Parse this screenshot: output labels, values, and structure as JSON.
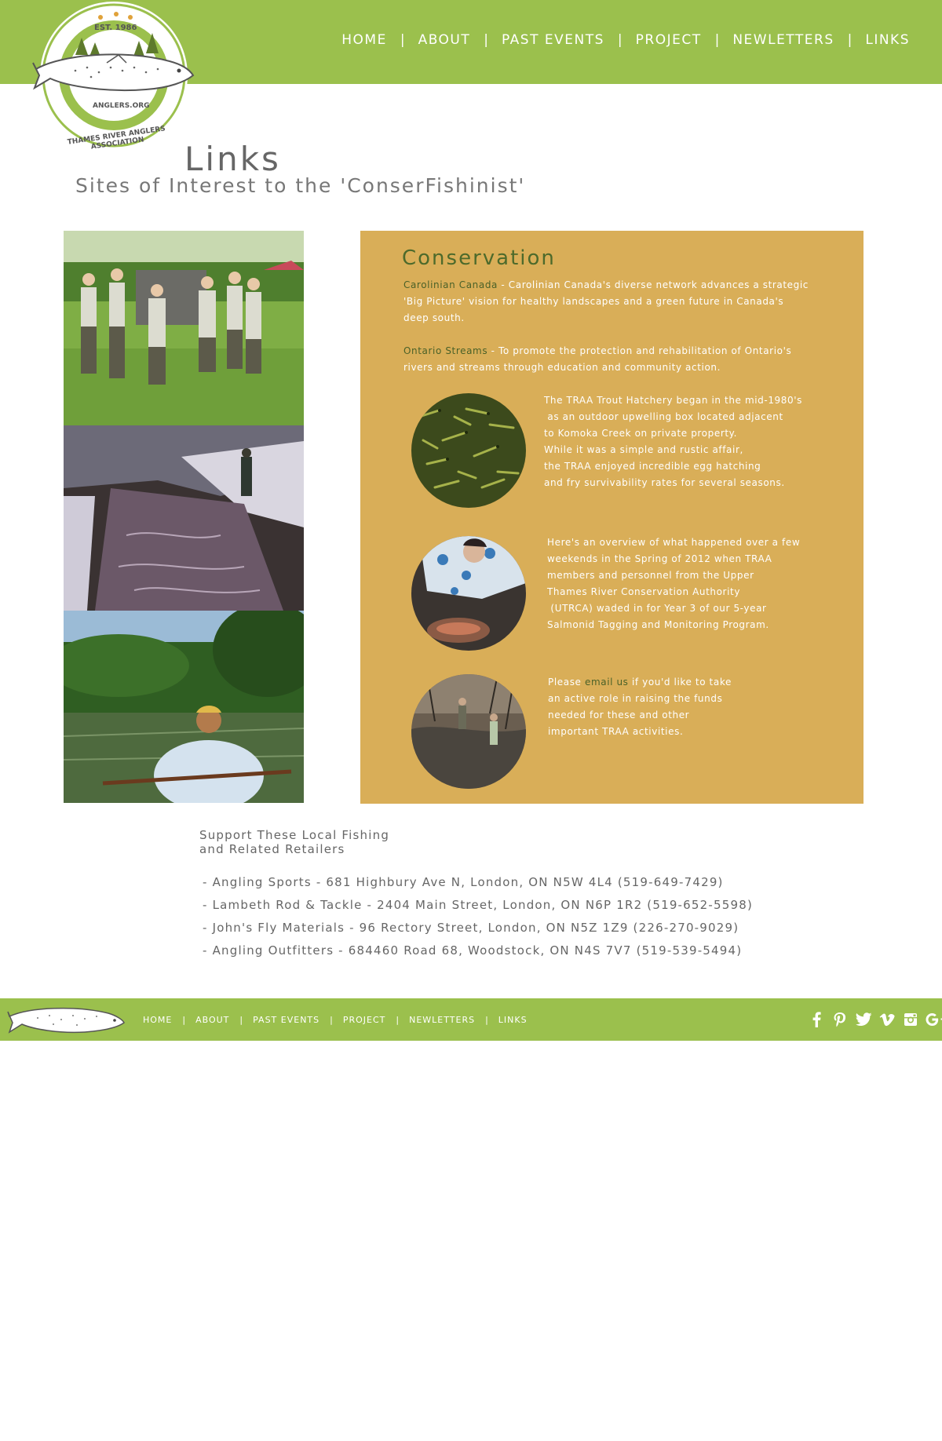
{
  "header": {
    "logo": {
      "est": "EST. 1986",
      "site": "ANGLERS.ORG",
      "name": "THAMES RIVER ANGLERS ASSOCIATION"
    },
    "nav": [
      "HOME",
      "ABOUT",
      "PAST EVENTS",
      "PROJECT",
      "NEWLETTERS",
      "LINKS"
    ]
  },
  "page": {
    "title": "Links",
    "subtitle": "Sites of Interest to the 'ConserFishinist'"
  },
  "conservation": {
    "title": "Conservation",
    "p1_link": "Carolinian Canada",
    "p1_text": " - Carolinian Canada's diverse network advances a strategic 'Big Picture' vision for healthy landscapes and a green future in Canada's deep south.",
    "p2_link": "Ontario Streams",
    "p2_text": " - To promote the protection and rehabilitation of Ontario's rivers and streams through education and community action.",
    "p3_lines": [
      "The TRAA Trout Hatchery began in the mid-1980's",
      " as an outdoor upwelling box located adjacent",
      "to Komoka Creek on private property.",
      "While it was a simple and rustic affair,",
      "the TRAA enjoyed incredible egg hatching",
      "and fry survivability rates for several seasons."
    ],
    "p4_lines": [
      "Here's an overview of what happened over a few",
      "weekends in the Spring of 2012 when TRAA",
      "members and personnel from the Upper",
      "Thames River Conservation Authority",
      " (UTRCA) waded in for Year 3 of our 5-year",
      "Salmonid Tagging and Monitoring Program."
    ],
    "p5_before": "Please ",
    "p5_link": "email us",
    "p5_after_lines": [
      " if you'd like to take",
      "an active role in raising the funds",
      "needed for these and other",
      "important TRAA activities."
    ]
  },
  "retailers": {
    "heading_line1": "Support These Local Fishing",
    "heading_line2": "and Related Retailers",
    "items": [
      "- Angling Sports - 681 Highbury Ave N, London, ON N5W 4L4 (519-649-7429)",
      "- Lambeth Rod & Tackle - 2404 Main Street, London, ON N6P 1R2 (519-652-5598)",
      "- John's Fly Materials - 96 Rectory Street, London, ON N5Z 1Z9 (226-270-9029)",
      "- Angling Outfitters - 684460 Road 68, Woodstock, ON N4S 7V7 (519-539-5494)"
    ]
  },
  "footer": {
    "nav": [
      "HOME",
      "ABOUT",
      "PAST EVENTS",
      "PROJECT",
      "NEWLETTERS",
      "LINKS"
    ],
    "social_icons": [
      "facebook-icon",
      "pinterest-icon",
      "twitter-icon",
      "vimeo-icon",
      "instagram-icon",
      "google-plus-icon"
    ]
  },
  "colors": {
    "brand_green": "#9bc04d",
    "panel_gold": "#d9ae58",
    "link_green": "#4a6128"
  }
}
